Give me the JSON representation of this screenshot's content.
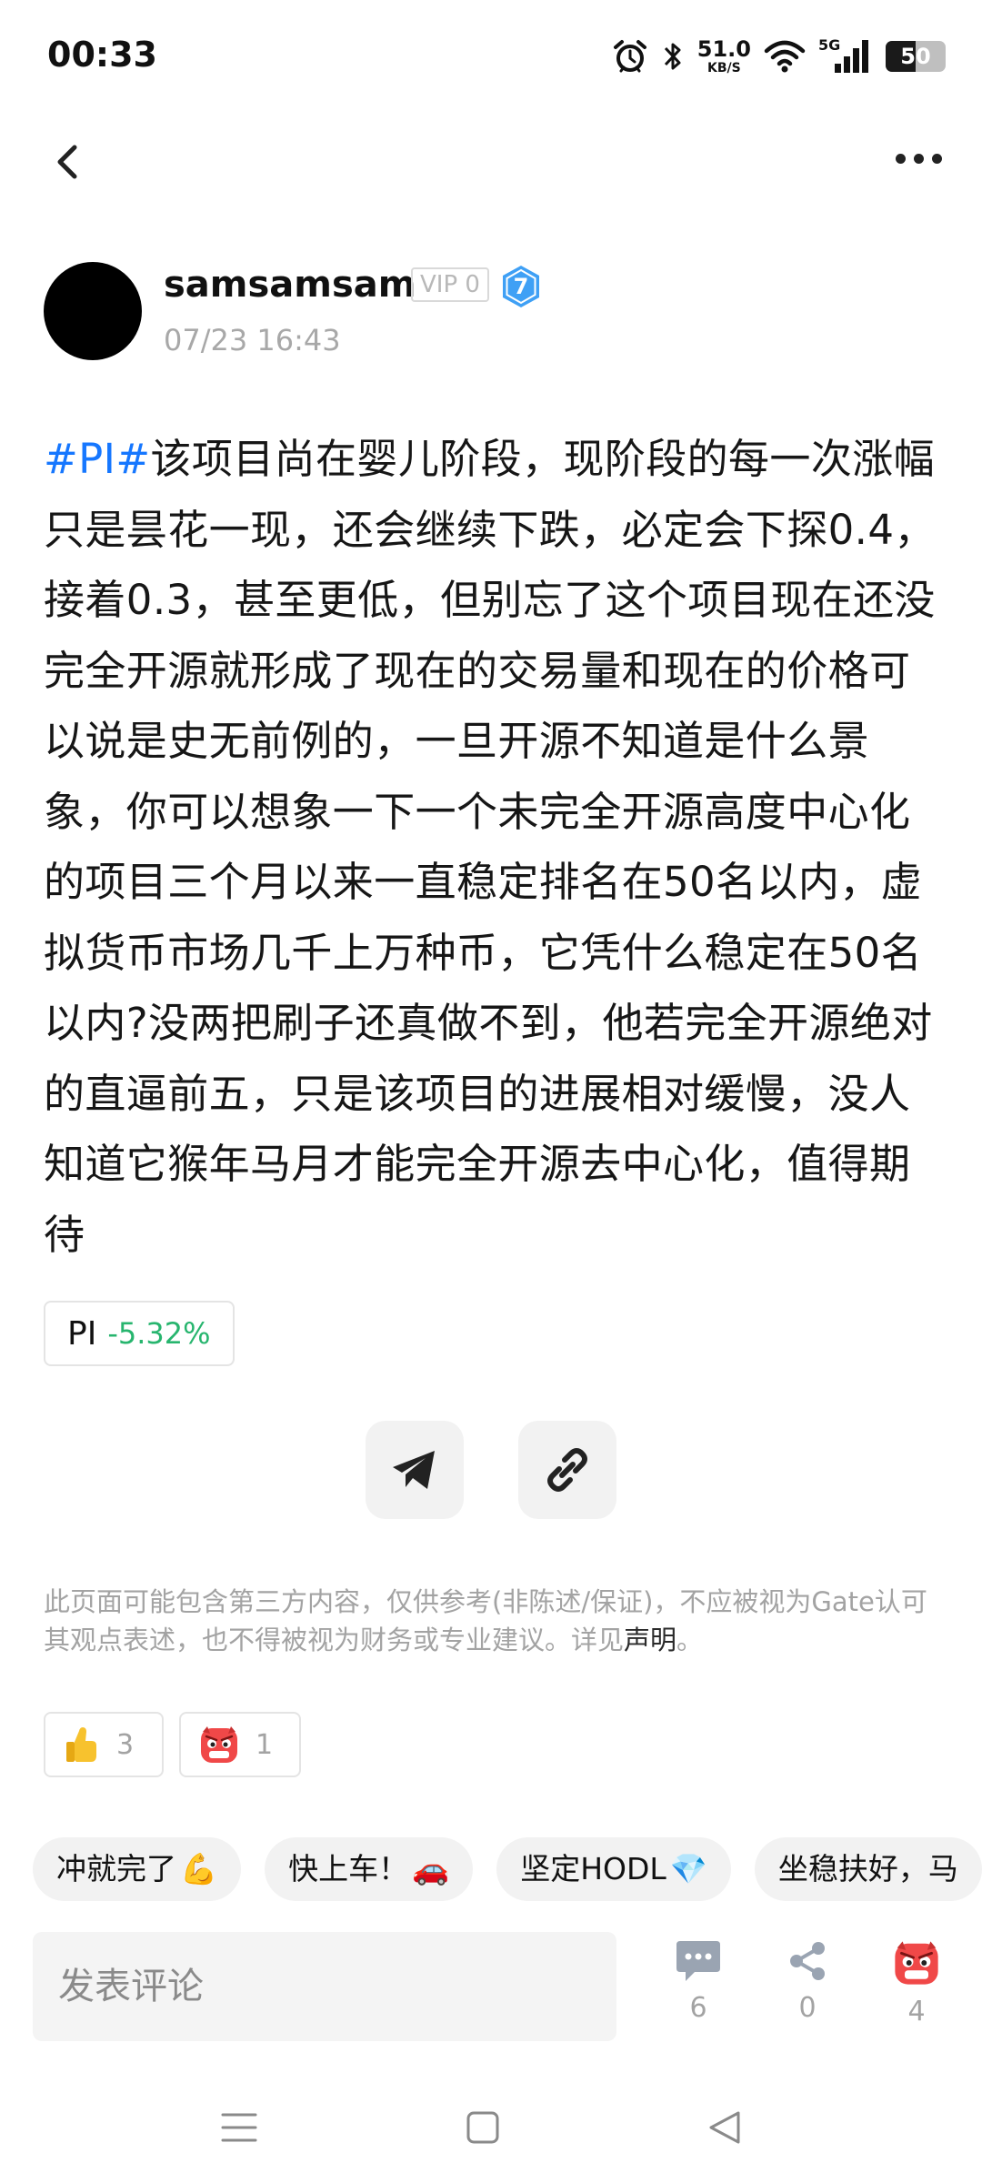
{
  "status_bar": {
    "time": "00:33",
    "net_speed_value": "51.0",
    "net_speed_unit": "KB/S",
    "network_type": "5G",
    "battery_level": "50",
    "battery_fraction": 0.5
  },
  "author": {
    "name": "samsamsam",
    "vip": "VIP 0",
    "level": "7",
    "post_time": "07/23 16:43"
  },
  "post": {
    "hashtag": "#PI#",
    "body": "该项目尚在婴儿阶段，现阶段的每一次涨幅只是昙花一现，还会继续下跌，必定会下探0.4，接着0.3，甚至更低，但别忘了这个项目现在还没完全开源就形成了现在的交易量和现在的价格可以说是史无前例的，一旦开源不知道是什么景象，你可以想象一下一个未完全开源高度中心化的项目三个月以来一直稳定排名在50名以内，虚拟货币市场几千上万种币，它凭什么稳定在50名以内?没两把刷子还真做不到，他若完全开源绝对的直逼前五，只是该项目的进展相对缓慢，没人知道它猴年马月才能完全开源去中心化，值得期待"
  },
  "coin": {
    "name": "PI",
    "change": "-5.32%"
  },
  "disclaimer": {
    "text": "此页面可能包含第三方内容，仅供参考(非陈述/保证)，不应被视为Gate认可其观点表述，也不得被视为财务或专业建议。详见",
    "link": "声明",
    "end": "。"
  },
  "reactions": [
    {
      "icon": "thumbs-up-emoji",
      "count": "3"
    },
    {
      "icon": "angry-devil-emoji",
      "count": "1"
    }
  ],
  "quick_comments": [
    {
      "text": "冲就完了",
      "emoji": "💪"
    },
    {
      "text": "快上车！",
      "emoji": "🚗"
    },
    {
      "text": "坚定HODL",
      "emoji": "💎"
    },
    {
      "text": "坐稳扶好，马",
      "emoji": ""
    }
  ],
  "bottom_bar": {
    "comment_placeholder": "发表评论",
    "comment_count": "6",
    "share_count": "0",
    "reaction_count": "4"
  },
  "colors": {
    "accent_blue": "#1677ff",
    "positive_green": "#27b56e",
    "level_badge": "#3fa0f5",
    "devil_red": "#f04848"
  }
}
